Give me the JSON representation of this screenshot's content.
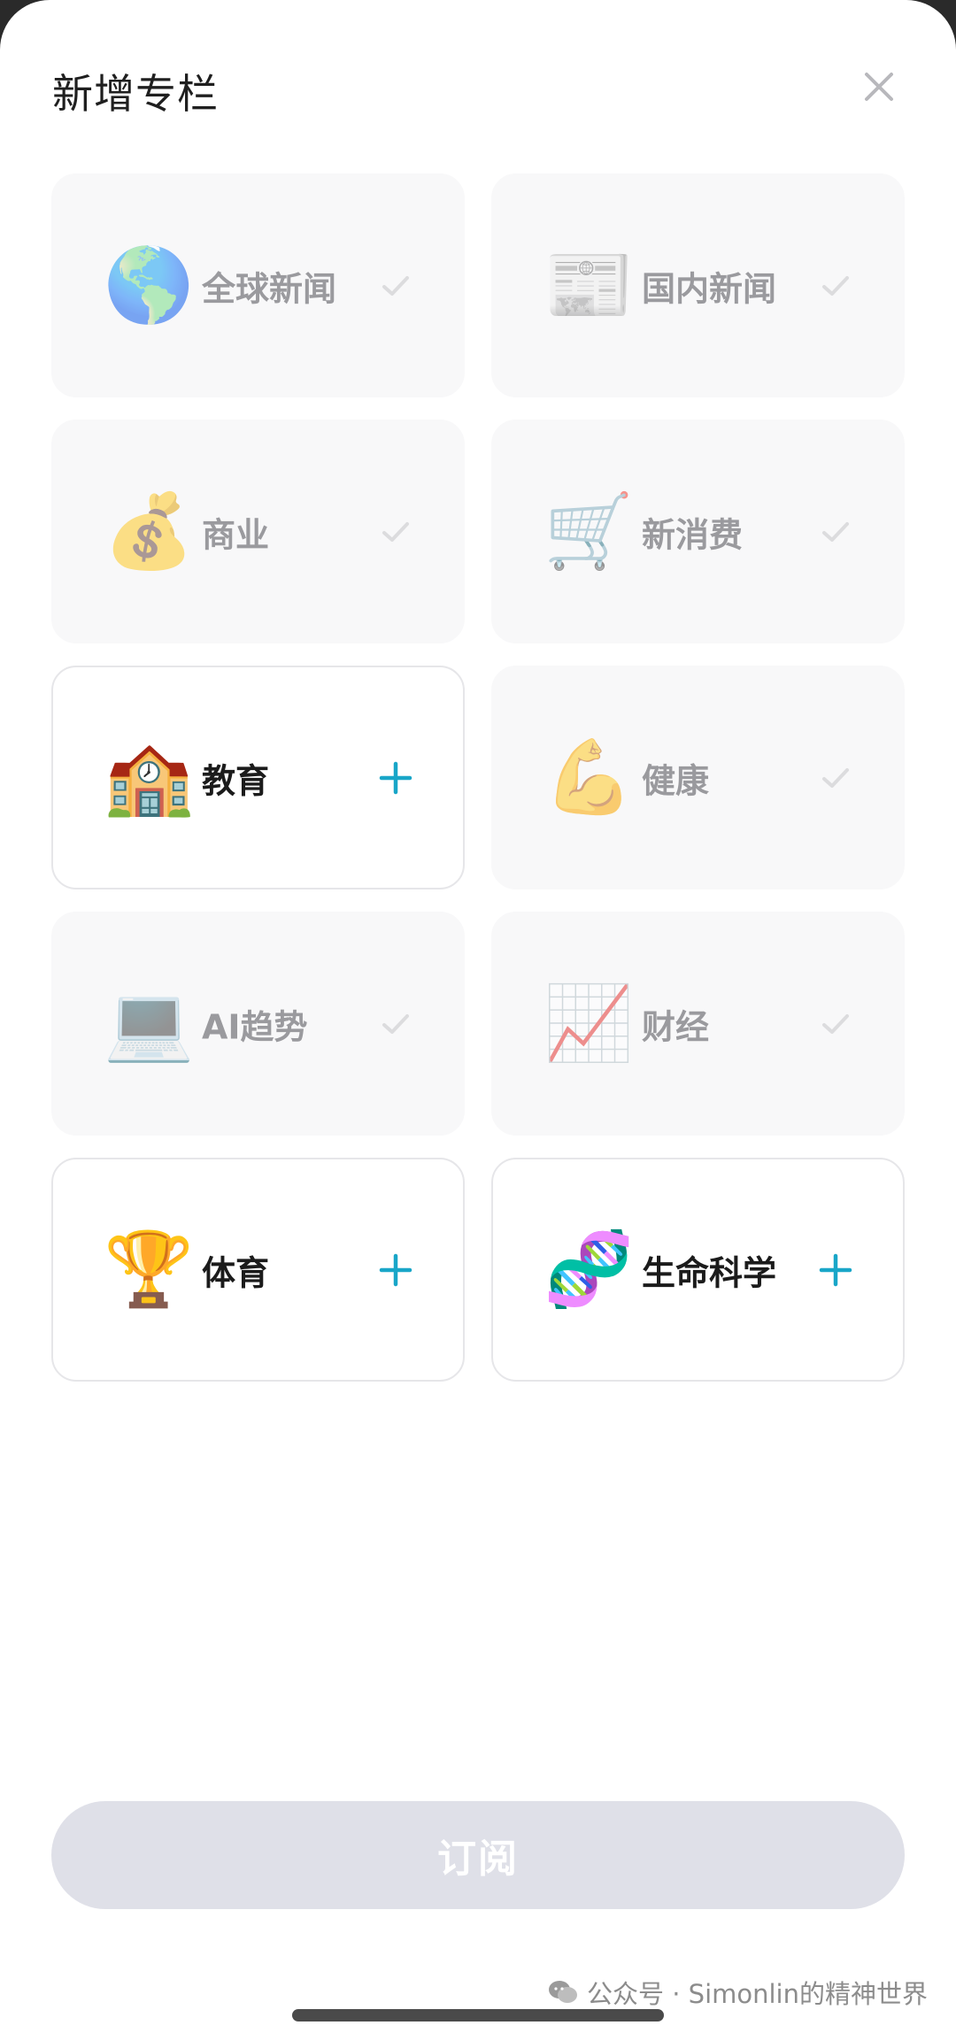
{
  "header": {
    "title": "新增专栏"
  },
  "colors": {
    "accent": "#19a6c8",
    "check": "#dcdcde",
    "button_disabled": "#dfe0e8"
  },
  "cards": [
    {
      "label": "全球新闻",
      "emoji": "🌎",
      "subscribed": true
    },
    {
      "label": "国内新闻",
      "emoji": "📰",
      "subscribed": true
    },
    {
      "label": "商业",
      "emoji": "💰",
      "subscribed": true
    },
    {
      "label": "新消费",
      "emoji": "🛒",
      "subscribed": true
    },
    {
      "label": "教育",
      "emoji": "🏫",
      "subscribed": false
    },
    {
      "label": "健康",
      "emoji": "💪",
      "subscribed": true
    },
    {
      "label": "AI趋势",
      "emoji": "💻",
      "subscribed": true
    },
    {
      "label": "财经",
      "emoji": "📈",
      "subscribed": true
    },
    {
      "label": "体育",
      "emoji": "🏆",
      "subscribed": false
    },
    {
      "label": "生命科学",
      "emoji": "🧬",
      "subscribed": false
    }
  ],
  "footer": {
    "subscribe_label": "订阅",
    "watermark": "公众号 · Simonlin的精神世界"
  }
}
